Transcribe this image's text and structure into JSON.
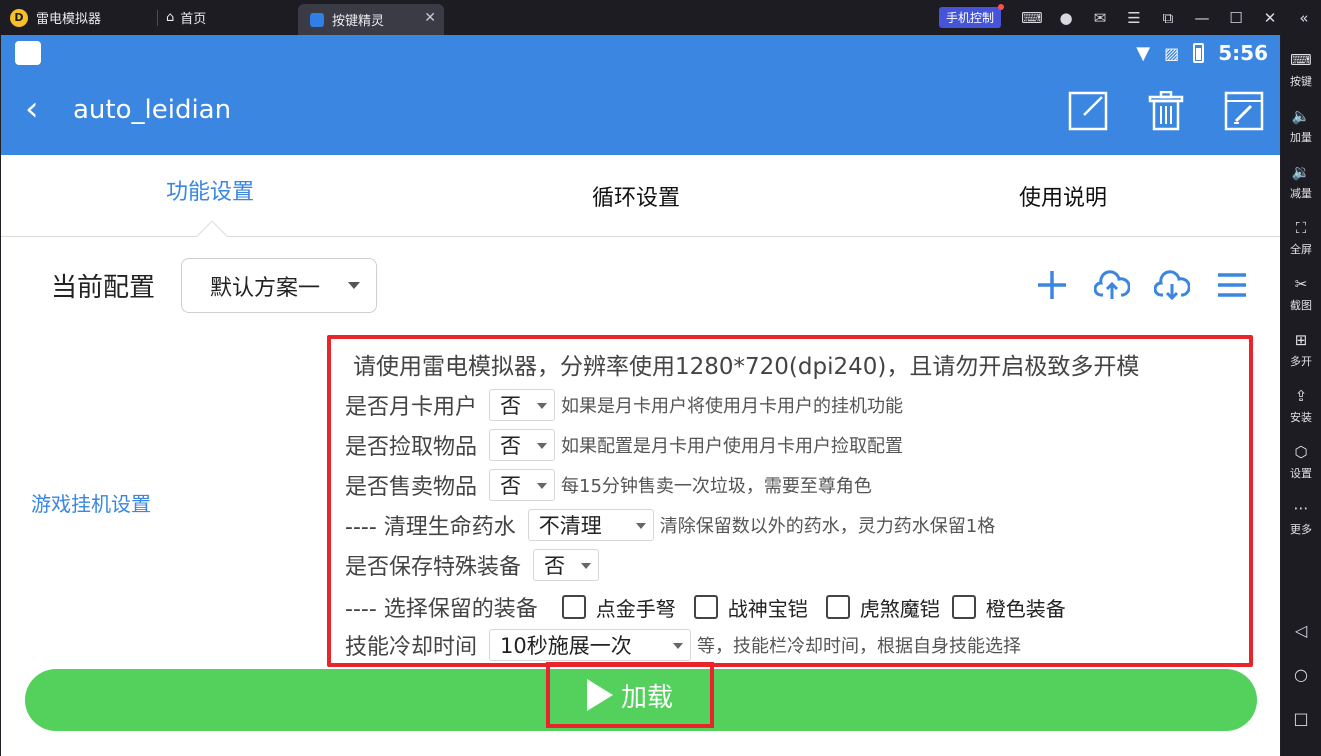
{
  "titlebar": {
    "app_name": "雷电模拟器",
    "home_label": "首页",
    "active_tab": "按键精灵",
    "phone_control": "手机控制"
  },
  "statusbar": {
    "time": "5:56"
  },
  "appbar": {
    "title": "auto_leidian"
  },
  "tabs": [
    {
      "label": "功能设置",
      "active": true
    },
    {
      "label": "循环设置",
      "active": false
    },
    {
      "label": "使用说明",
      "active": false
    }
  ],
  "config": {
    "label": "当前配置",
    "selected": "默认方案一"
  },
  "side_label": "游戏挂机设置",
  "panel": {
    "notice": "请使用雷电模拟器，分辨率使用1280*720(dpi240)，且请勿开启极致多开模",
    "rows": [
      {
        "label": "是否月卡用户",
        "value": "否",
        "desc": "如果是月卡用户将使用月卡用户的挂机功能"
      },
      {
        "label": "是否捡取物品",
        "value": "否",
        "desc": "如果配置是月卡用户使用月卡用户捡取配置"
      },
      {
        "label": "是否售卖物品",
        "value": "否",
        "desc": "每15分钟售卖一次垃圾，需要至尊角色"
      },
      {
        "label": "---- 清理生命药水",
        "value": "不清理",
        "desc": "清除保留数以外的药水，灵力药水保留1格"
      },
      {
        "label": "是否保存特殊装备",
        "value": "否",
        "desc": ""
      }
    ],
    "equip": {
      "label": "---- 选择保留的装备",
      "options": [
        "点金手弩",
        "战神宝铠",
        "虎煞魔铠",
        "橙色装备"
      ]
    },
    "partial_row": {
      "label": "技能冷却时间",
      "value": "10秒施展一次",
      "desc": "等，技能栏冷却时间，根据自身技能选择"
    }
  },
  "load_button": "加载",
  "sidebar": {
    "items": [
      "按键",
      "加量",
      "减量",
      "全屏",
      "截图",
      "多开",
      "安装",
      "设置",
      "更多"
    ]
  },
  "colors": {
    "primary": "#3a86e0",
    "green": "#53d15c",
    "highlight": "#e8252b"
  }
}
